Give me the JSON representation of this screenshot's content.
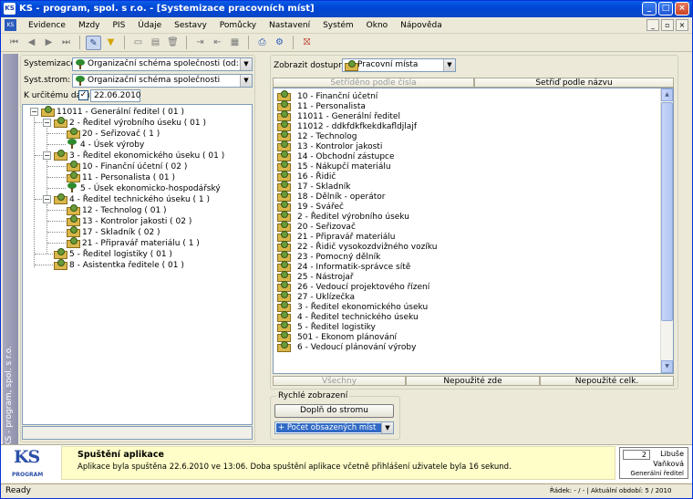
{
  "window": {
    "title": "KS - program, spol. s r.o. - [Systemizace pracovních míst]",
    "buttons": [
      "_",
      "□",
      "×"
    ]
  },
  "menu": [
    "Evidence",
    "Mzdy",
    "PIS",
    "Údaje",
    "Sestavy",
    "Pomůcky",
    "Nastavení",
    "Systém",
    "Okno",
    "Nápověda"
  ],
  "side_strip_text": "KS - program, spol. s r.o.",
  "left_panel": {
    "systemizace_label": "Systemizace:",
    "systemizace_value": "Organizační schéma společnosti (od:1.1.2006)",
    "syst_strom_label": "Syst.strom:",
    "syst_strom_value": "Organizační schéma společnosti",
    "date_label": "K určitému datu",
    "date_checked": true,
    "date_value": "22.06.2010",
    "tree": [
      {
        "text": "11011 - Generální ředitel  ( 01 )"
      },
      {
        "text": "2 - Ředitel výrobního úseku  ( 01 )"
      },
      {
        "text": "20 - Seřizovač  ( 1 )"
      },
      {
        "text": "4 - Úsek výroby"
      },
      {
        "text": "3 - Ředitel ekonomického úseku  ( 01 )"
      },
      {
        "text": "10 - Finanční účetní  ( 02 )"
      },
      {
        "text": "11 - Personalista  ( 01 )"
      },
      {
        "text": "5 - Úsek ekonomicko-hospodářský"
      },
      {
        "text": "4 - Ředitel technického úseku  ( 1 )"
      },
      {
        "text": "12 - Technolog  ( 01 )"
      },
      {
        "text": "13 - Kontrolor jakosti  ( 02 )"
      },
      {
        "text": "17 - Skladník  ( 02 )"
      },
      {
        "text": "21 - Připravář materiálu  ( 1 )"
      },
      {
        "text": "5 - Ředitel logistiky  ( 01 )"
      },
      {
        "text": "8 - Asistentka ředitele  ( 01 )"
      }
    ]
  },
  "right_panel": {
    "zobrazit_label": "Zobrazit dostupné :",
    "zobrazit_value": "Pracovní místa",
    "sort_by_number": "Setříděno podle čísla",
    "sort_by_name": "Setřiď podle názvu",
    "items": [
      "10 - Finanční účetní",
      "11 - Personalista",
      "11011 - Generální ředitel",
      "11012 - ddkfdkfkekdkafldjlajf",
      "12 - Technolog",
      "13 - Kontrolor jakosti",
      "14 - Obchodní zástupce",
      "15 - Nákupčí materiálu",
      "16 - Řidič",
      "17 - Skladník",
      "18 - Dělník - operátor",
      "19 - Svářeč",
      "2 - Ředitel výrobního úseku",
      "20 - Seřizovač",
      "21 - Připravář materiálu",
      "22 - Řidič vysokozdvižného vozíku",
      "23 - Pomocný dělník",
      "24 - Informatik-správce sítě",
      "25 - Nástrojař",
      "26 - Vedoucí projektového řízení",
      "27 - Uklízečka",
      "3 - Ředitel ekonomického úseku",
      "4 - Ředitel technického úseku",
      "5 - Ředitel logistiky",
      "501 - Ekonom plánování",
      "6 - Vedoucí plánování výroby"
    ],
    "filter_all": "Všechny",
    "filter_unused_here": "Nepoužité zde",
    "filter_unused_total": "Nepoužité celk.",
    "quick_view_label": "Rychlé zobrazení",
    "fill_tree_button": "Doplň do stromu",
    "quick_combo_value": "+ Počet obsazených míst"
  },
  "status": {
    "logo_text": "KS",
    "logo_sub": "PROGRAM",
    "message_title": "Spuštění aplikace",
    "message_text": "Aplikace byla spuštěna 22.6.2010 ve 13:06. Doba spuštění aplikace včetně přihlášení uživatele byla 16 sekund.",
    "user_number": "2",
    "user_first": "Libuše",
    "user_last": "Vaňková",
    "user_role": "Generální ředitel",
    "ready": "Ready",
    "right_status": "Řádek: - / - | Aktuální období: 5 / 2010"
  }
}
